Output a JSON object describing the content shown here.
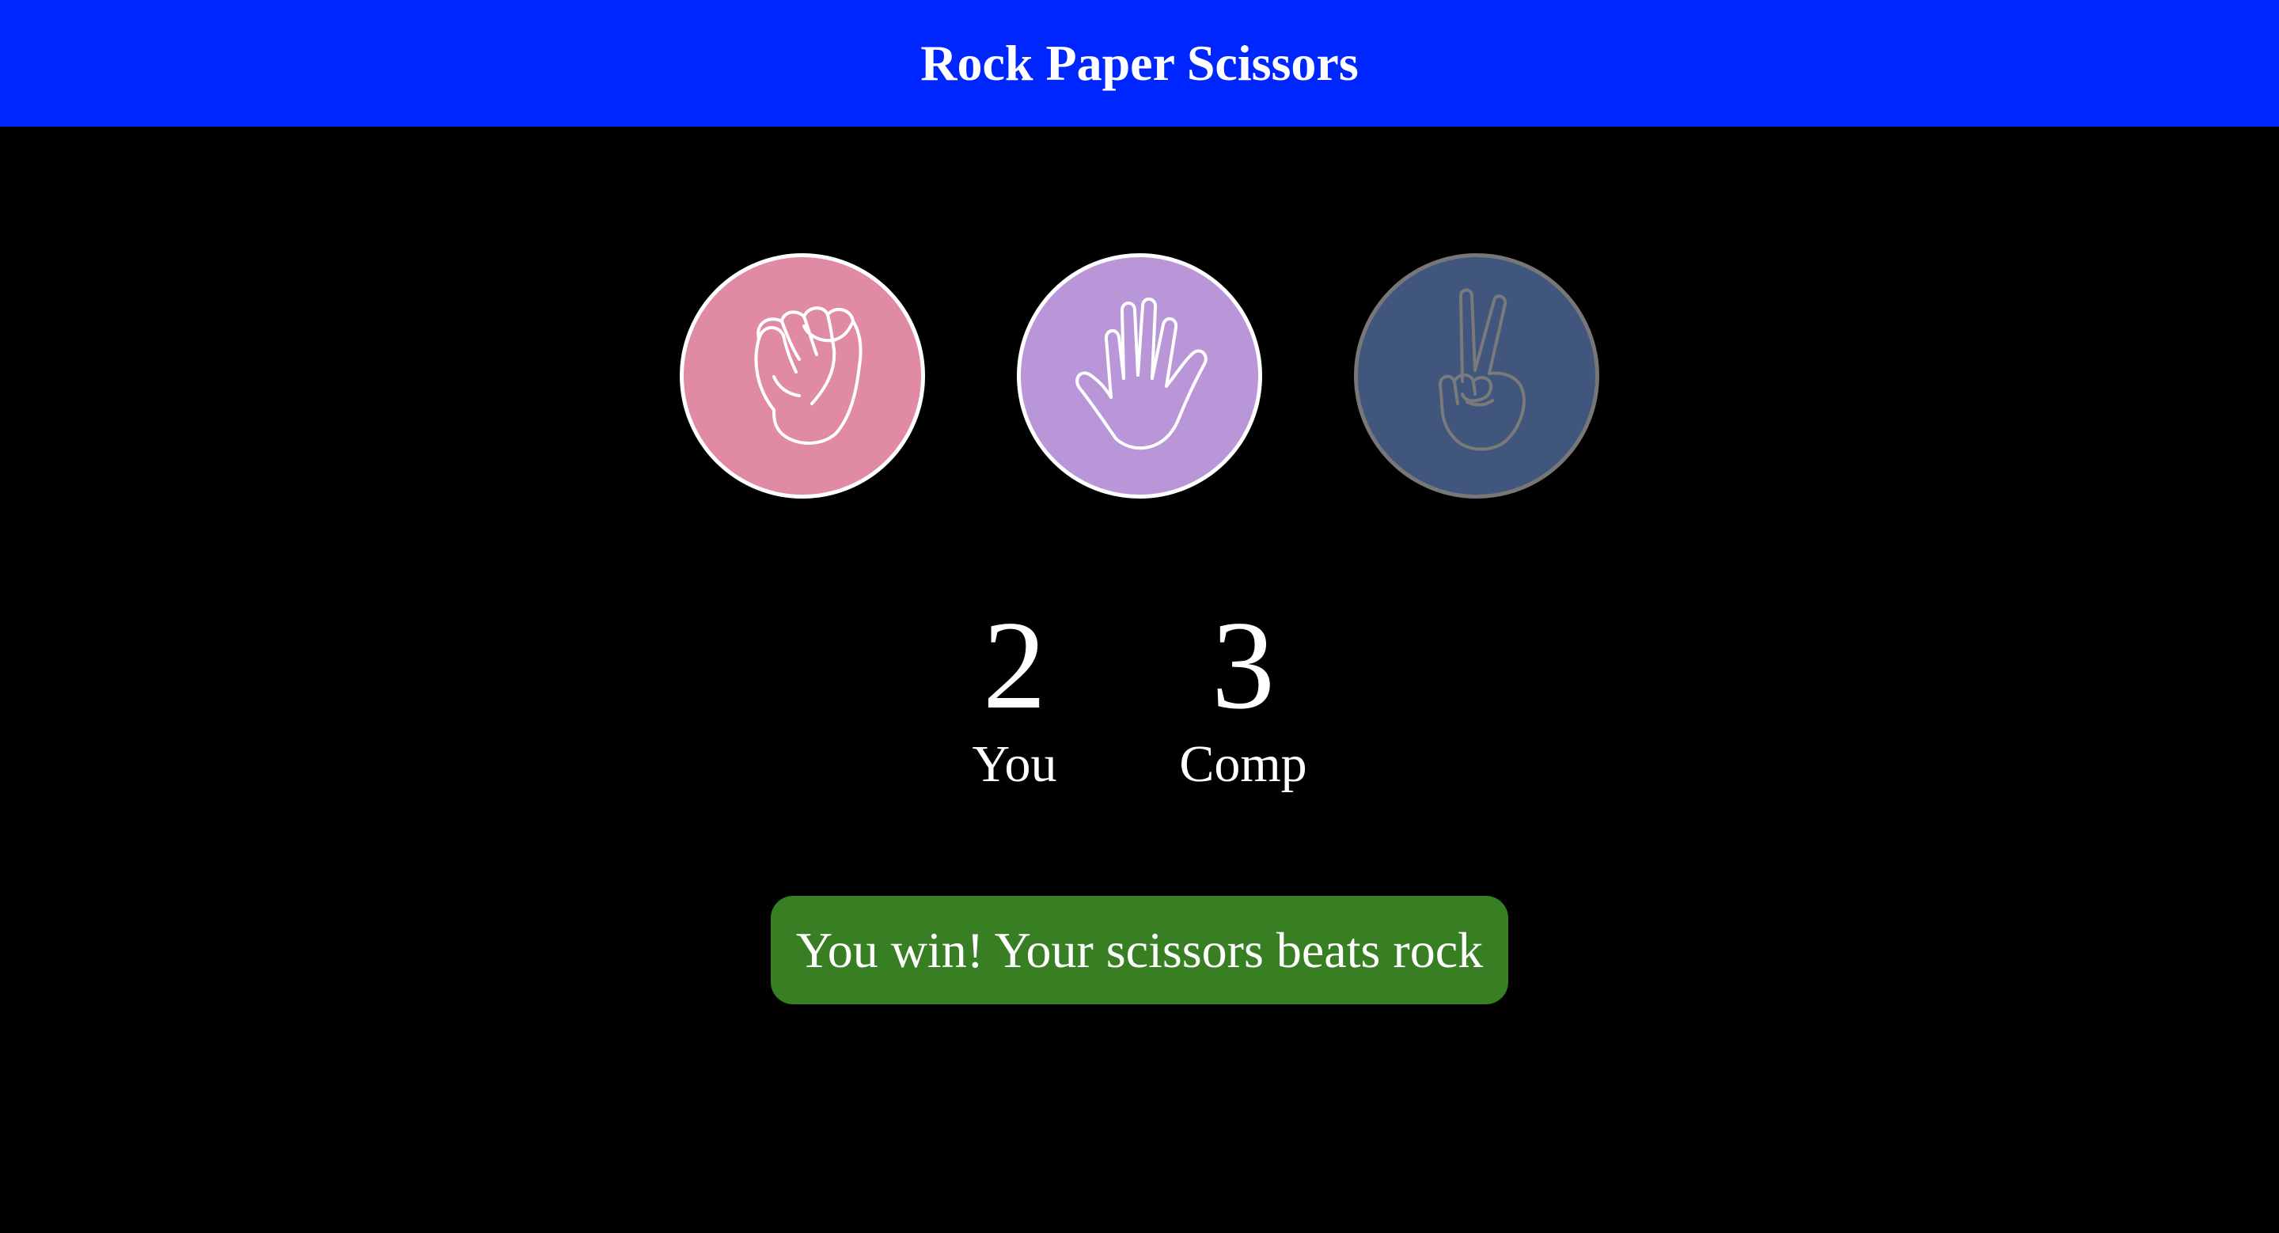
{
  "header": {
    "title": "Rock Paper Scissors",
    "background": "#0026ff"
  },
  "choices": [
    {
      "id": "rock",
      "icon": "fist-icon",
      "color": "#e08aa3",
      "active": true
    },
    {
      "id": "paper",
      "icon": "open-hand-icon",
      "color": "#b996d8",
      "active": true
    },
    {
      "id": "scissors",
      "icon": "peace-hand-icon",
      "color": "#40567d",
      "active": false
    }
  ],
  "scores": {
    "you": {
      "value": "2",
      "label": "You"
    },
    "comp": {
      "value": "3",
      "label": "Comp"
    }
  },
  "result": {
    "message": "You win! Your scissors beats rock",
    "color": "#377f22"
  }
}
